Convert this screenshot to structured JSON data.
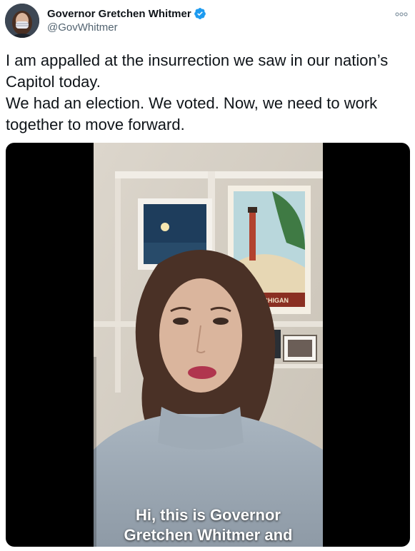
{
  "author": {
    "display_name": "Governor Gretchen Whitmer",
    "handle": "@GovWhitmer",
    "verified_icon": "verified-badge-icon",
    "avatar": "avatar"
  },
  "tweet": {
    "lines": [
      "I am appalled at the insurrection we saw in our nation’s",
      "Capitol today.",
      "We had an election. We voted. Now, we need to work",
      "together to move forward."
    ]
  },
  "media": {
    "type": "video",
    "caption_lines": [
      "Hi, this is Governor",
      "Gretchen Whitmer and"
    ],
    "poster_text": "E MICHIGAN"
  },
  "colors": {
    "verified": "#1d9bf0",
    "text": "#0f1419",
    "secondary_text": "#536471",
    "media_background": "#000000"
  }
}
